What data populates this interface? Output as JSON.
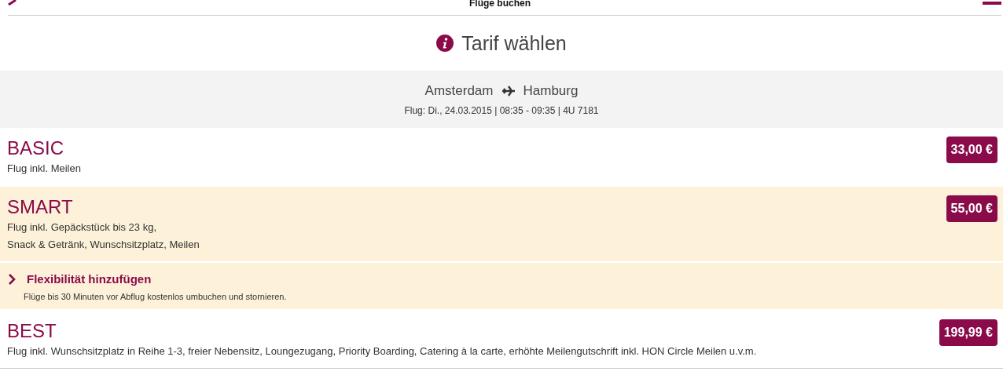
{
  "header": {
    "title": "Flüge buchen"
  },
  "heading": "Tarif wählen",
  "route": {
    "from": "Amsterdam",
    "to": "Hamburg",
    "flight": "Flug: Di., 24.03.2015 | 08:35 - 09:35 | 4U 7181"
  },
  "fares": [
    {
      "name": "BASIC",
      "description": "Flug inkl. Meilen",
      "price": "33,00 €",
      "selected": false
    },
    {
      "name": "SMART",
      "description": "Flug inkl. Gepäckstück bis 23 kg,\nSnack & Getränk, Wunschsitzplatz, Meilen",
      "price": "55,00 €",
      "selected": true,
      "addon": {
        "title": "Flexibilität hinzufügen",
        "text": "Flüge bis 30 Minuten vor Abflug kostenlos umbuchen und stornieren.",
        "expanded": false
      }
    },
    {
      "name": "BEST",
      "description": "Flug inkl. Wunschsitzplatz in Reihe 1-3, freier Nebensitz, Loungezugang, Priority Boarding, Catering à la carte, erhöhte Meilengutschrift inkl. HON Circle Meilen u.v.m.",
      "price": "199,99 €",
      "selected": false
    }
  ]
}
